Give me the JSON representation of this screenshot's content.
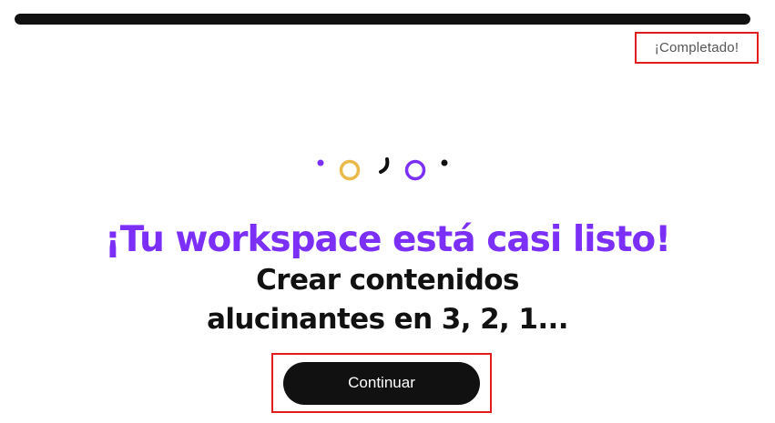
{
  "progress": {
    "value_percent": 100,
    "fill_color": "#111111",
    "track_color": "#e6e6e6"
  },
  "status": {
    "label": "¡Completado!"
  },
  "decoration": {
    "icons": [
      "purple-dot-icon",
      "yellow-ring-icon",
      "black-arc-icon",
      "purple-ring-icon",
      "black-dot-icon"
    ],
    "colors": {
      "purple": "#7b2ff7",
      "yellow": "#e9b949",
      "black": "#111111"
    }
  },
  "headline": {
    "text": "¡Tu workspace está casi listo!",
    "color": "#7b2ff7"
  },
  "subheadline": {
    "line1": "Crear contenidos",
    "line2": "alucinantes en 3, 2, 1...",
    "color": "#111111"
  },
  "cta": {
    "label": "Continuar",
    "background": "#111111"
  }
}
